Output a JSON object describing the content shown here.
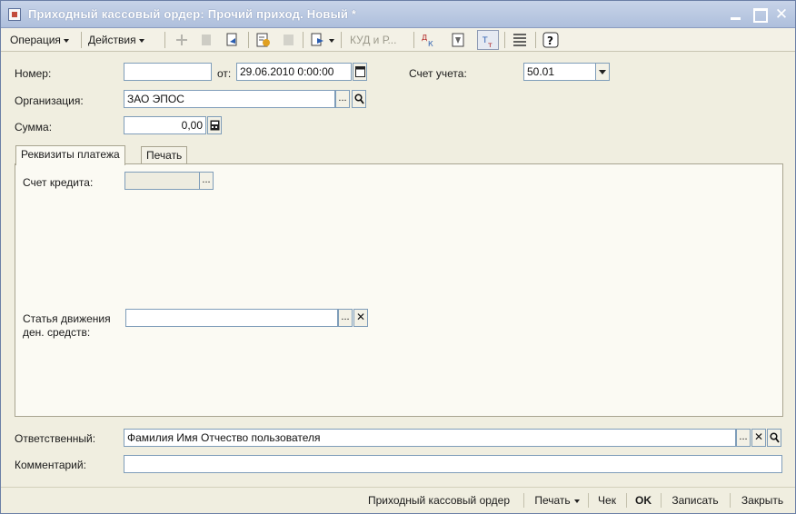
{
  "window": {
    "title": "Приходный кассовый ордер: Прочий приход. Новый *",
    "minimize": "",
    "maximize": "",
    "close": "✕"
  },
  "toolbar": {
    "operations": "Операция",
    "actions": "Действия",
    "kudir_button": "КУД и Р...",
    "help_glyph": "?"
  },
  "form": {
    "number_label": "Номер:",
    "number_value": "",
    "date_label": "от:",
    "date_value": "29.06.2010  0:00:00",
    "account_label": "Счет учета:",
    "account_value": "50.01",
    "org_label": "Организация:",
    "org_value": "ЗАО ЭПОС",
    "sum_label": "Сумма:",
    "sum_value": "0,00"
  },
  "tabs": [
    {
      "label": "Реквизиты платежа",
      "active": true
    },
    {
      "label": "Печать",
      "active": false
    }
  ],
  "tab_payment": {
    "credit_account_label": "Счет кредита:",
    "credit_account_value": "",
    "cashflow_label_line1": "Статья движения",
    "cashflow_label_line2": "ден. средств:",
    "cashflow_value": ""
  },
  "footer_fields": {
    "responsible_label": "Ответственный:",
    "responsible_value": "Фамилия Имя Отчество пользователя",
    "comment_label": "Комментарий:",
    "comment_value": ""
  },
  "bottom_buttons": {
    "pko": "Приходный кассовый ордер",
    "print": "Печать",
    "check": "Чек",
    "ok": "OK",
    "save": "Записать",
    "close": "Закрыть"
  },
  "buttons": {
    "ellipsis": "...",
    "clear": "✕",
    "search": "⌕"
  },
  "colors": {
    "titlebar": "#aebfdc",
    "window_bg": "#f0eee0",
    "field_border": "#7f9db9"
  }
}
